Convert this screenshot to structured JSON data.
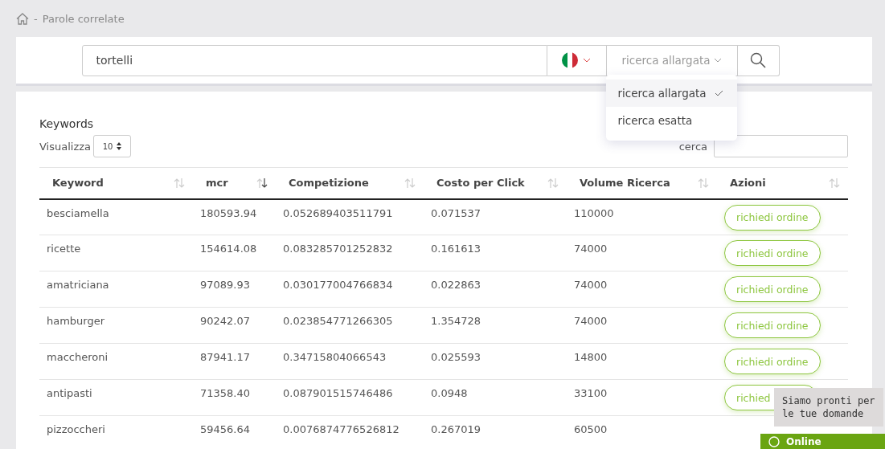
{
  "breadcrumb": {
    "separator": "-",
    "title": "Parole correlate"
  },
  "search": {
    "value": "tortelli",
    "mode": "ricerca allargata",
    "dropdown_open": true,
    "options": [
      {
        "label": "ricerca allargata",
        "selected": true
      },
      {
        "label": "ricerca esatta",
        "selected": false
      }
    ]
  },
  "table_card": {
    "title": "Keywords",
    "show_label": "Visualizza",
    "page_size": "10",
    "filter_label": "cerca",
    "columns": [
      {
        "label": "Keyword",
        "sorted": false
      },
      {
        "label": "mcr",
        "sorted": true
      },
      {
        "label": "Competizione",
        "sorted": false
      },
      {
        "label": "Costo per Click",
        "sorted": false
      },
      {
        "label": "Volume Ricerca",
        "sorted": false
      },
      {
        "label": "Azioni",
        "sorted": false
      }
    ],
    "rows": [
      {
        "keyword": "besciamella",
        "mcr": "180593.94",
        "competition": "0.052689403511791",
        "cpc": "0.071537",
        "volume": "110000",
        "action": "richiedi ordine"
      },
      {
        "keyword": "ricette",
        "mcr": "154614.08",
        "competition": "0.083285701252832",
        "cpc": "0.161613",
        "volume": "74000",
        "action": "richiedi ordine"
      },
      {
        "keyword": "amatriciana",
        "mcr": "97089.93",
        "competition": "0.030177004766834",
        "cpc": "0.022863",
        "volume": "74000",
        "action": "richiedi ordine"
      },
      {
        "keyword": "hamburger",
        "mcr": "90242.07",
        "competition": "0.023854771266305",
        "cpc": "1.354728",
        "volume": "74000",
        "action": "richiedi ordine"
      },
      {
        "keyword": "maccheroni",
        "mcr": "87941.17",
        "competition": "0.34715804066543",
        "cpc": "0.025593",
        "volume": "14800",
        "action": "richiedi ordine"
      },
      {
        "keyword": "antipasti",
        "mcr": "71358.40",
        "competition": "0.087901515746486",
        "cpc": "0.0948",
        "volume": "33100",
        "action": "richied"
      },
      {
        "keyword": "pizzoccheri",
        "mcr": "59456.64",
        "competition": "0.0076874776526812",
        "cpc": "0.267019",
        "volume": "60500"
      }
    ]
  },
  "chat": {
    "tooltip": "Siamo pronti per le tue domande",
    "status": "Online"
  }
}
